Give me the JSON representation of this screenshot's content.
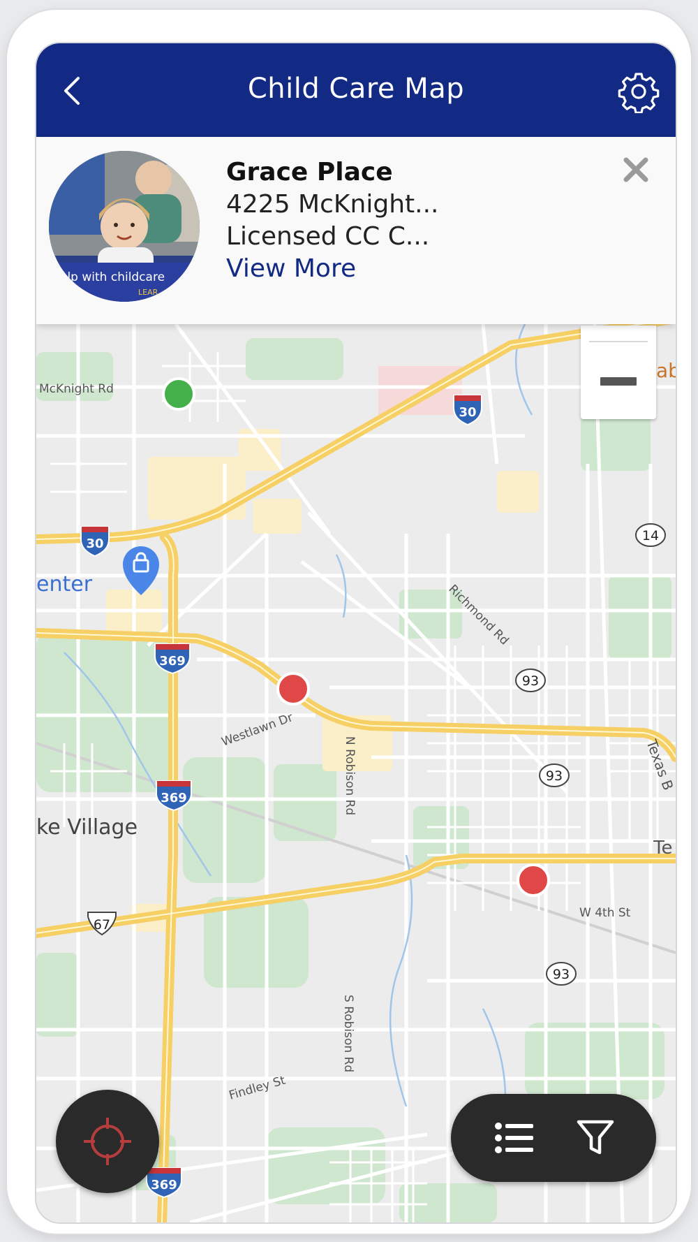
{
  "header": {
    "title": "Child Care Map"
  },
  "card": {
    "name": "Grace Place",
    "address": "4225 McKnight...",
    "type": "Licensed CC C...",
    "link": "View More",
    "avatar_text": "elp with childcare",
    "avatar_small": "LEAR"
  },
  "map": {
    "labels": {
      "mcknight": "McKnight Rd",
      "center": "enter",
      "richmond": "Richmond Rd",
      "westlawn": "Westlawn Dr",
      "n_robison": "N Robison Rd",
      "s_robison": "S Robison Rd",
      "village": "ke Village",
      "w4th": "W 4th St",
      "findley": "Findley St",
      "texas": "Texas B",
      "te": "Te",
      "ab": "ab"
    },
    "shields": {
      "i30_top": "30",
      "i30_left": "30",
      "i369_a": "369",
      "i369_b": "369",
      "i369_c": "369",
      "r14": "14",
      "r93_a": "93",
      "r93_b": "93",
      "r93_c": "93",
      "us67": "67"
    }
  },
  "colors": {
    "header": "#132a84",
    "marker_green": "#43b04a",
    "marker_red": "#e04848",
    "highway": "#f6cf65",
    "button_dark": "#2a2a2a"
  },
  "icons": {
    "back": "chevron-left-icon",
    "settings": "gear-icon",
    "close": "close-icon",
    "locate": "crosshair-icon",
    "list": "list-icon",
    "filter": "filter-icon"
  }
}
